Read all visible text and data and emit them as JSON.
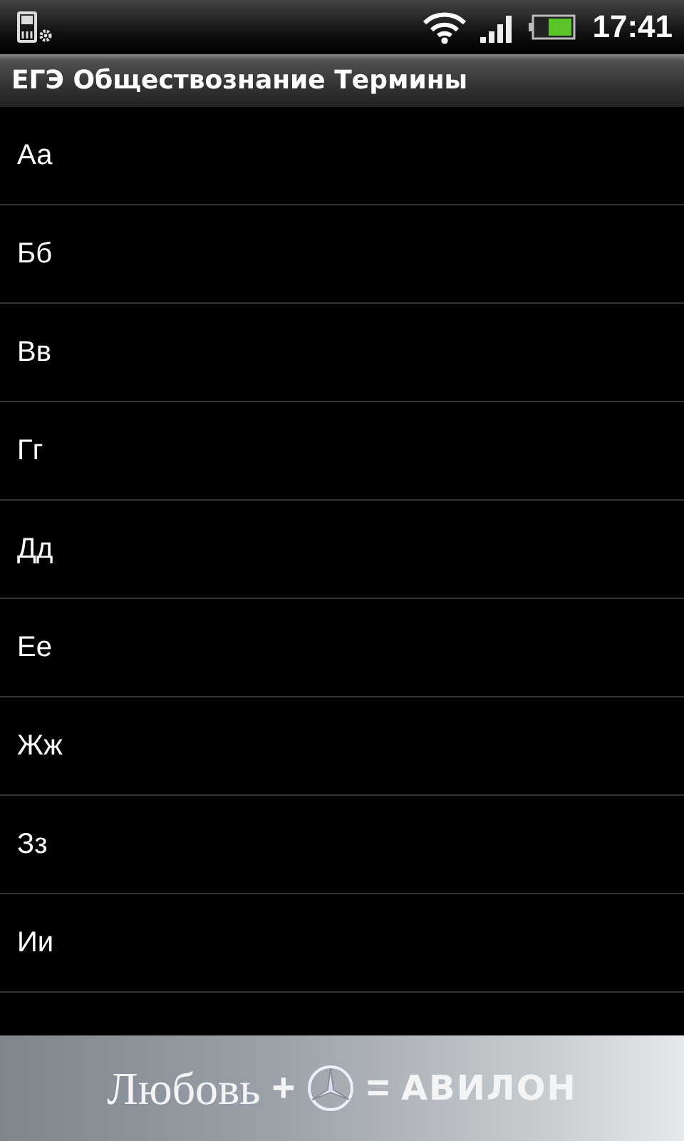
{
  "status_bar": {
    "time": "17:41"
  },
  "title_bar": {
    "title": "ЕГЭ Обществознание Термины"
  },
  "letters": [
    {
      "label": "Аа"
    },
    {
      "label": "Бб"
    },
    {
      "label": "Вв"
    },
    {
      "label": "Гг"
    },
    {
      "label": "Дд"
    },
    {
      "label": "Ее"
    },
    {
      "label": "Жж"
    },
    {
      "label": "Зз"
    },
    {
      "label": "Ии"
    }
  ],
  "ad_banner": {
    "word": "Любовь",
    "plus": "+",
    "equals": "=",
    "brand": "АВИЛОН"
  }
}
